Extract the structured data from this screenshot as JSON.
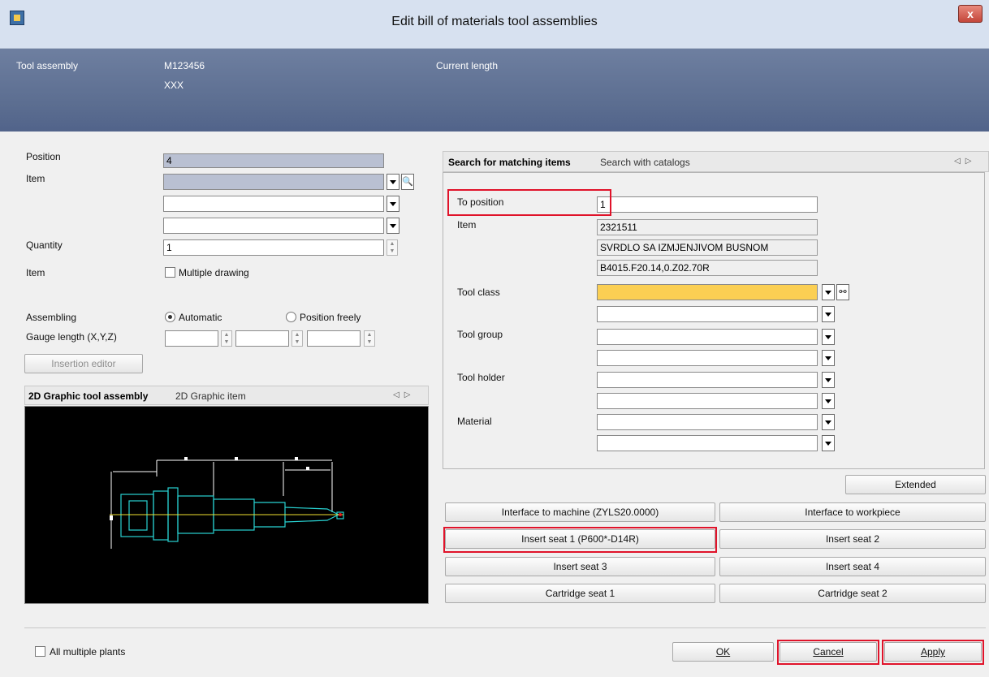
{
  "window": {
    "title": "Edit bill of materials tool assemblies",
    "close_label": "x"
  },
  "header": {
    "tool_assembly_label": "Tool assembly",
    "tool_assembly_id": "M123456",
    "tool_assembly_desc": "XXX",
    "current_length_label": "Current length"
  },
  "left": {
    "position_label": "Position",
    "position_value": "4",
    "item_label": "Item",
    "item_values": [
      "",
      "",
      ""
    ],
    "quantity_label": "Quantity",
    "quantity_value": "1",
    "item2_label": "Item",
    "multiple_drawing_label": "Multiple drawing",
    "assembling_label": "Assembling",
    "automatic_label": "Automatic",
    "position_freely_label": "Position freely",
    "gauge_length_label": "Gauge length (X,Y,Z)",
    "insertion_editor_label": "Insertion editor",
    "tabs": [
      "2D Graphic tool assembly",
      "2D Graphic item"
    ]
  },
  "right": {
    "tabs": [
      "Search for matching items",
      "Search with catalogs"
    ],
    "to_position_label": "To position",
    "to_position_value": "1",
    "item_label": "Item",
    "item_lines": [
      "2321511",
      "SVRDLO SA IZMJENJIVOM BUSNOM",
      "B4015.F20.14,0.Z02.70R"
    ],
    "tool_class_label": "Tool class",
    "tool_group_label": "Tool group",
    "tool_holder_label": "Tool holder",
    "material_label": "Material",
    "extended_label": "Extended",
    "seat_buttons": [
      "Interface to machine (ZYLS20.0000)",
      "Interface to workpiece",
      "Insert seat 1 (P600*-D14R)",
      "Insert seat 2",
      "Insert seat 3",
      "Insert seat 4",
      "Cartridge seat 1",
      "Cartridge seat 2"
    ]
  },
  "footer": {
    "all_multiple_plants_label": "All multiple plants",
    "ok_label": "OK",
    "cancel_label": "Cancel",
    "apply_label": "Apply"
  },
  "colors": {
    "highlight": "#e0132a",
    "header_band": "#5b6d90",
    "active_field": "#fbcf53"
  },
  "icons": [
    "app-icon",
    "close-icon",
    "dropdown-arrow-icon",
    "search-icon",
    "binoculars-icon",
    "spinner-icon",
    "tab-nav-arrows-icon"
  ]
}
